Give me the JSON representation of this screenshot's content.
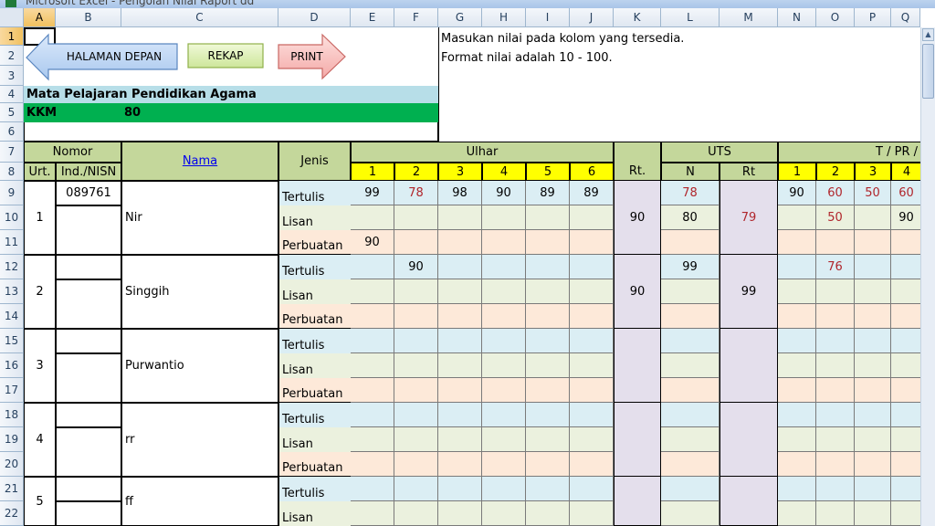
{
  "window": {
    "title": "Microsoft Excel - Pengolah Nilai Raport dd"
  },
  "columns": [
    "A",
    "B",
    "C",
    "D",
    "E",
    "F",
    "G",
    "H",
    "I",
    "J",
    "K",
    "L",
    "M",
    "N",
    "O",
    "P",
    "Q"
  ],
  "rows": [
    "1",
    "2",
    "3",
    "4",
    "5",
    "6",
    "7",
    "8",
    "9",
    "10",
    "11",
    "12",
    "13",
    "14",
    "15",
    "16",
    "17",
    "18",
    "19",
    "20",
    "21",
    "22"
  ],
  "buttons": {
    "home": "HALAMAN DEPAN",
    "rekap": "REKAP",
    "print": "PRINT"
  },
  "notes": {
    "line1": "Masukan nilai pada kolom yang tersedia.",
    "line2": "Format nilai adalah 10 - 100."
  },
  "subject": {
    "label": "Mata Pelajaran Pendidikan Agama",
    "kkm_label": "KKM",
    "kkm_value": "80"
  },
  "header": {
    "nomor": "Nomor",
    "urt": "Urt.",
    "nisn": "Ind./NISN",
    "nama": "Nama",
    "jenis": "Jenis",
    "ulhar": "Ulhar",
    "ulhar_cols": [
      "1",
      "2",
      "3",
      "4",
      "5",
      "6"
    ],
    "rt": "Rt.",
    "uts": "UTS",
    "uts_n": "N",
    "uts_rt": "Rt",
    "tpr": "T / PR /",
    "tpr_cols": [
      "1",
      "2",
      "3",
      "4"
    ]
  },
  "jenis": [
    "Tertulis",
    "Lisan",
    "Perbuatan"
  ],
  "students": [
    {
      "urt": "1",
      "nisn": "089761",
      "nama": "Nir",
      "rt": "90",
      "uts_rt": "79",
      "rows": [
        {
          "u": [
            "99",
            "78",
            "98",
            "90",
            "89",
            "89"
          ],
          "uts_n": "78",
          "t": [
            "90",
            "60",
            "50",
            "60"
          ]
        },
        {
          "u": [
            "",
            "",
            "",
            "",
            "",
            ""
          ],
          "uts_n": "80",
          "t": [
            "",
            "50",
            "",
            "90"
          ]
        },
        {
          "u": [
            "90",
            "",
            "",
            "",
            "",
            ""
          ],
          "uts_n": "",
          "t": [
            "",
            "",
            "",
            ""
          ]
        }
      ]
    },
    {
      "urt": "2",
      "nisn": "",
      "nama": "Singgih",
      "rt": "90",
      "uts_rt": "99",
      "rows": [
        {
          "u": [
            "",
            "90",
            "",
            "",
            "",
            ""
          ],
          "uts_n": "99",
          "t": [
            "",
            "76",
            "",
            ""
          ]
        },
        {
          "u": [
            "",
            "",
            "",
            "",
            "",
            ""
          ],
          "uts_n": "",
          "t": [
            "",
            "",
            "",
            ""
          ]
        },
        {
          "u": [
            "",
            "",
            "",
            "",
            "",
            ""
          ],
          "uts_n": "",
          "t": [
            "",
            "",
            "",
            ""
          ]
        }
      ]
    },
    {
      "urt": "3",
      "nisn": "",
      "nama": "Purwantio",
      "rt": "",
      "uts_rt": "",
      "rows": []
    },
    {
      "urt": "4",
      "nisn": "",
      "nama": "rr",
      "rt": "",
      "uts_rt": "",
      "rows": []
    },
    {
      "urt": "5",
      "nisn": "",
      "nama": "ff",
      "rt": "",
      "uts_rt": "",
      "rows": []
    }
  ],
  "colors": {
    "tertulis": "#dbeef4",
    "lisan": "#ebf1de",
    "perbuatan": "#fde9d9",
    "rt_col": "#e4dfec",
    "header_green": "#c4d79b",
    "header_yellow": "#ffff00",
    "subject_blue": "#b7dee8",
    "kkm_green": "#00b050",
    "red_value": "#b0262c"
  }
}
